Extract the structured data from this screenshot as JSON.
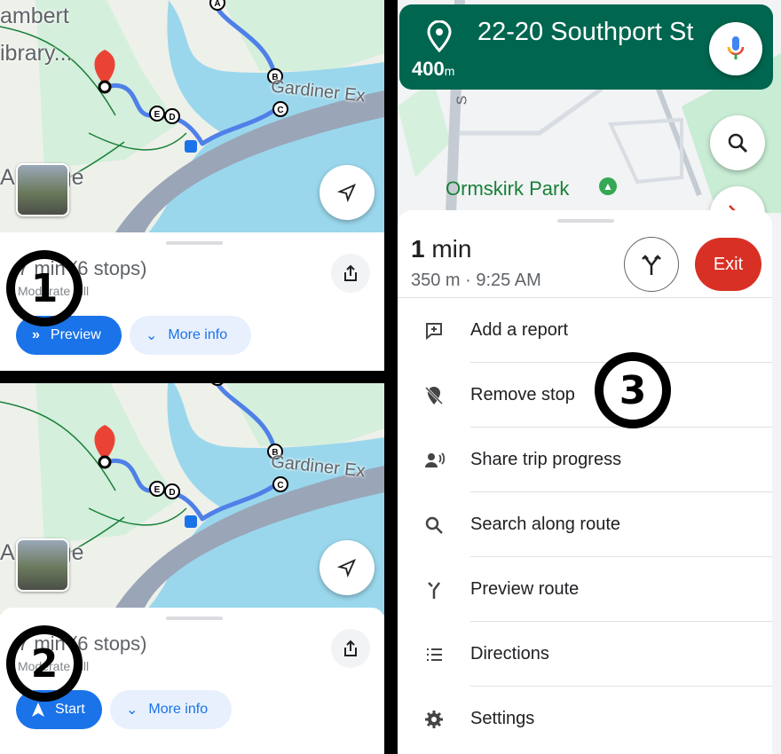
{
  "map": {
    "labels": {
      "top_left_1": "ambert",
      "top_left_2": "ibrary...",
      "road": "Gardiner Ex",
      "bridge": "A  Bridge"
    },
    "stops": [
      "A",
      "B",
      "C",
      "D",
      "E"
    ]
  },
  "panel1": {
    "annotation": "1",
    "title": "7 min (6 stops)",
    "subtitle": "Moderate hill",
    "primary_label": "Preview",
    "primary_icon": "double-chevron-right-icon",
    "secondary_label": "More info"
  },
  "panel2": {
    "annotation": "2",
    "title": "7 min (6 stops)",
    "subtitle": "Moderate hill",
    "primary_label": "Start",
    "primary_icon": "navigation-arrow-icon",
    "secondary_label": "More info"
  },
  "panel3": {
    "annotation": "3",
    "nav_header": {
      "distance": "400",
      "distance_unit": "m",
      "street": "22-20 Southport St",
      "color": "#00664f"
    },
    "map_labels": {
      "park": "Ormskirk Park",
      "street": "S"
    },
    "trip": {
      "duration_value": "1",
      "duration_unit": "min",
      "details": "350 m · 9:25 AM",
      "exit_label": "Exit"
    },
    "menu": [
      {
        "label": "Add a report",
        "icon": "add-report-icon"
      },
      {
        "label": "Remove stop",
        "icon": "remove-stop-icon"
      },
      {
        "label": "Share trip progress",
        "icon": "share-trip-icon"
      },
      {
        "label": "Search along route",
        "icon": "search-icon"
      },
      {
        "label": "Preview route",
        "icon": "preview-route-icon"
      },
      {
        "label": "Directions",
        "icon": "directions-list-icon"
      },
      {
        "label": "Settings",
        "icon": "gear-icon"
      }
    ]
  },
  "colors": {
    "primary": "#1a73e8",
    "exit": "#d93025",
    "route": "#4f80e8",
    "water": "#9ad7ec",
    "park": "#c8ecd4"
  }
}
